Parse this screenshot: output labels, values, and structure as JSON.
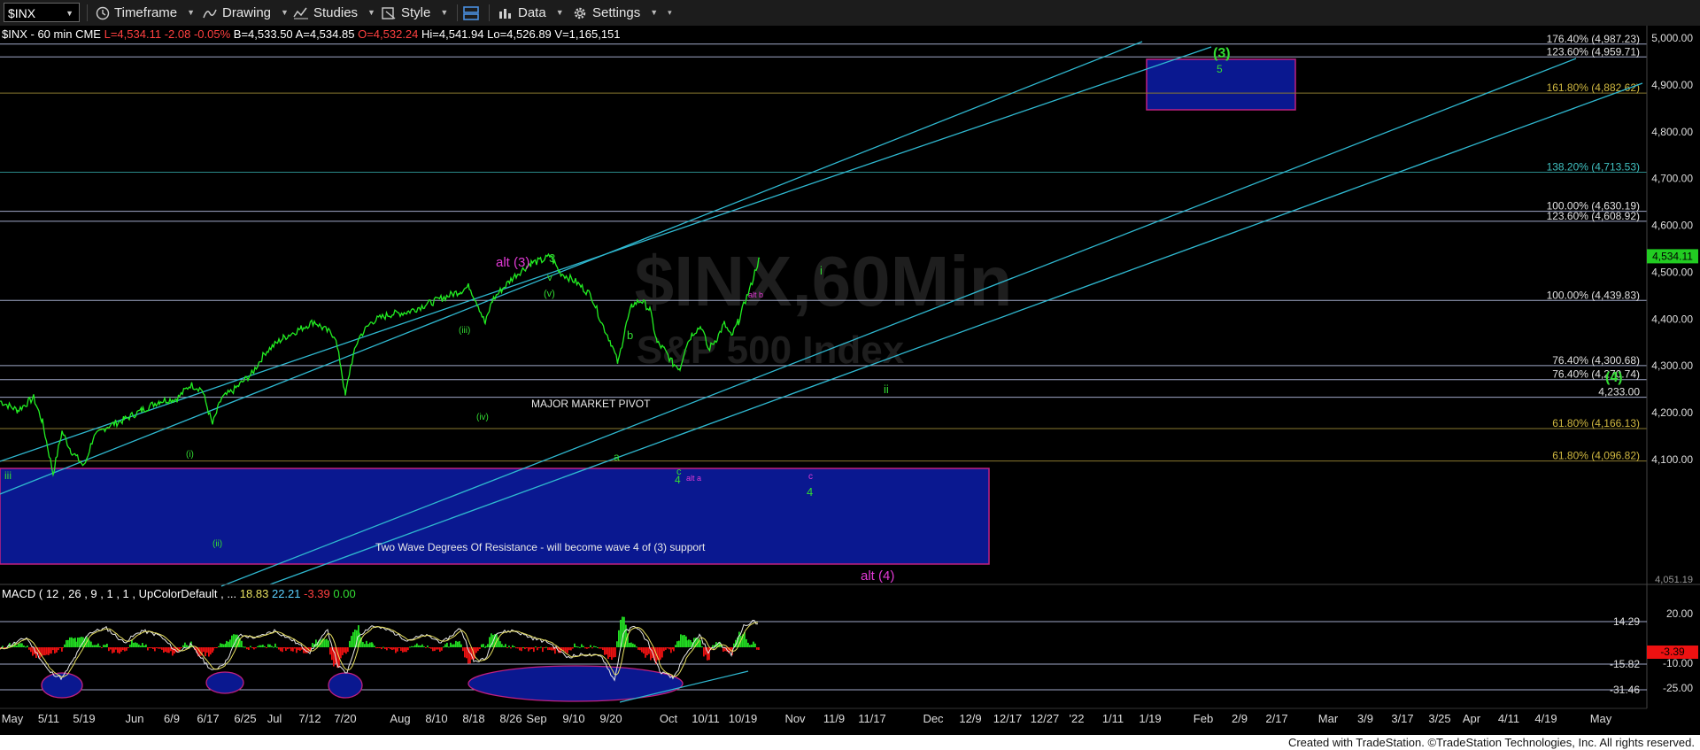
{
  "toolbar": {
    "symbol": "$INX",
    "timeframe": "Timeframe",
    "drawing": "Drawing",
    "studies": "Studies",
    "style": "Style",
    "data": "Data",
    "settings": "Settings"
  },
  "info": {
    "name": "$INX - 60 min  CME",
    "last": "L=4,534.11",
    "chg": "-2.08",
    "pct": "-0.05%",
    "bid": "B=4,533.50",
    "ask": "A=4,534.85",
    "open": "O=4,532.24",
    "hi": "Hi=4,541.94",
    "lo": "Lo=4,526.89",
    "vol": "V=1,165,151"
  },
  "watermark": {
    "line1": "$INX,60Min",
    "line2": "S&P 500 Index"
  },
  "colors": {
    "bg": "#000000",
    "price": "#22ee22",
    "channel": "#2fb8d0",
    "box": "#0a1890",
    "magenta": "#e23ad6",
    "green_label": "#33dd33"
  },
  "chart_data": {
    "type": "line",
    "title": "$INX - 60 min",
    "y_axis": {
      "ticks": [
        "5,000.00",
        "4,900.00",
        "4,800.00",
        "4,700.00",
        "4,600.00",
        "4,500.00",
        "4,400.00",
        "4,300.00",
        "4,200.00",
        "4,100.00"
      ],
      "values": [
        5000,
        4900,
        4800,
        4700,
        4600,
        4500,
        4400,
        4300,
        4200,
        4100
      ],
      "current": "4,534.11",
      "partial": "4,051.19"
    },
    "x_axis": {
      "ticks": [
        "May",
        "5/11",
        "5/19",
        "Jun",
        "6/9",
        "6/17",
        "6/25",
        "Jul",
        "7/12",
        "7/20",
        "Aug",
        "8/10",
        "8/18",
        "8/26",
        "Sep",
        "9/10",
        "9/20",
        "Oct",
        "10/11",
        "10/19",
        "Nov",
        "11/9",
        "11/17",
        "Dec",
        "12/9",
        "12/17",
        "12/27",
        "'22",
        "1/11",
        "1/19",
        "Feb",
        "2/9",
        "2/17",
        "Mar",
        "3/9",
        "3/17",
        "3/25",
        "Apr",
        "4/11",
        "4/19",
        "May"
      ]
    },
    "levels": [
      {
        "label": "176.40% (4,987.23)",
        "value": 4987.23
      },
      {
        "label": "123.60% (4,959.71)",
        "value": 4959.71
      },
      {
        "label": "161.80% (4,882.62)",
        "value": 4882.62
      },
      {
        "label": "138.20% (4,713.53)",
        "value": 4713.53
      },
      {
        "label": "100.00% (4,630.19)",
        "value": 4630.19
      },
      {
        "label": "123.60% (4,608.92)",
        "value": 4608.92
      },
      {
        "label": "100.00% (4,439.83)",
        "value": 4439.83
      },
      {
        "label": "76.40% (4,300.68)",
        "value": 4300.68
      },
      {
        "label": "76.40% (4,270.74)",
        "value": 4270.74
      },
      {
        "label": "4,233.00",
        "value": 4233.0
      },
      {
        "label": "61.80% (4,166.13)",
        "value": 4166.13
      },
      {
        "label": "61.80% (4,096.82)",
        "value": 4096.82
      }
    ],
    "annotations": {
      "pivot_title": "MAJOR MARKET PIVOT",
      "pivot_sub": "Two Wave Degrees Of Resistance - will become wave 4 of (3) support",
      "wave3": "(3)",
      "wave5": "5",
      "wave4_big": "(4)",
      "alt3": "alt (3)",
      "alt4": "alt (4)",
      "w3": "3",
      "wv": "v",
      "wv2": "(v)",
      "wiii": "(iii)",
      "wiv": "(iv)",
      "wi": "(i)",
      "wii": "(ii)",
      "iii": "iii",
      "b": "b",
      "a": "a",
      "c": "c",
      "four": "4",
      "alta": "alt a",
      "altb": "alt b",
      "i": "i",
      "ii": "ii",
      "c2": "c",
      "four2": "4"
    },
    "macd": {
      "header": "MACD ( 12 , 26 , 9 , 1 , 1 , UpColorDefault , ...",
      "v1": "18.83",
      "v2": "22.21",
      "v3": "-3.39",
      "v4": "0.00",
      "ticks": [
        "20.00",
        "0.00",
        "-10.00",
        "-25.00"
      ],
      "levels": [
        "14.29",
        "-15.82",
        "-31.46"
      ],
      "current": "-3.39"
    }
  },
  "footer": "Created with TradeStation. ©TradeStation Technologies, Inc. All rights reserved."
}
